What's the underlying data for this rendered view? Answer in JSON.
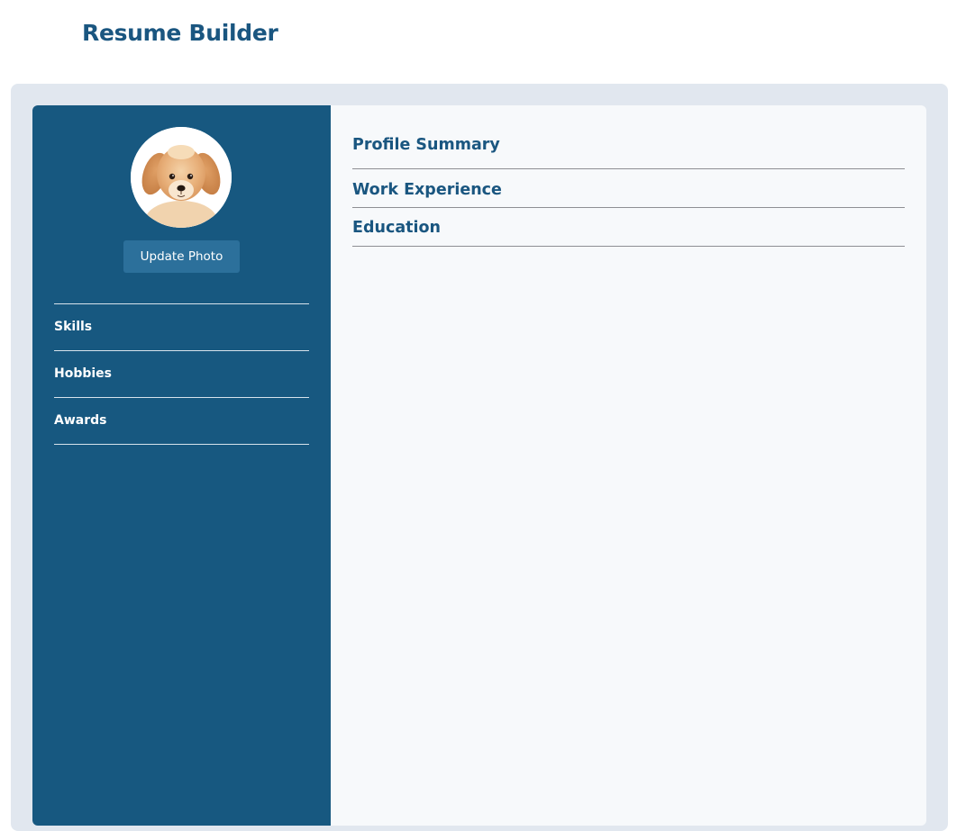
{
  "header": {
    "title": "Resume Builder"
  },
  "sidebar": {
    "avatar_image": "golden-retriever-puppy-photo",
    "update_photo_label": "Update Photo",
    "items": [
      {
        "label": "Skills"
      },
      {
        "label": "Hobbies"
      },
      {
        "label": "Awards"
      }
    ]
  },
  "main": {
    "sections": [
      {
        "label": "Profile Summary"
      },
      {
        "label": "Work Experience"
      },
      {
        "label": "Education"
      }
    ]
  },
  "colors": {
    "brand_blue": "#175880",
    "title_blue": "#1a5680",
    "button_blue": "#2c709b",
    "panel_bg": "#e1e7ef",
    "card_bg": "#f7f9fb"
  }
}
